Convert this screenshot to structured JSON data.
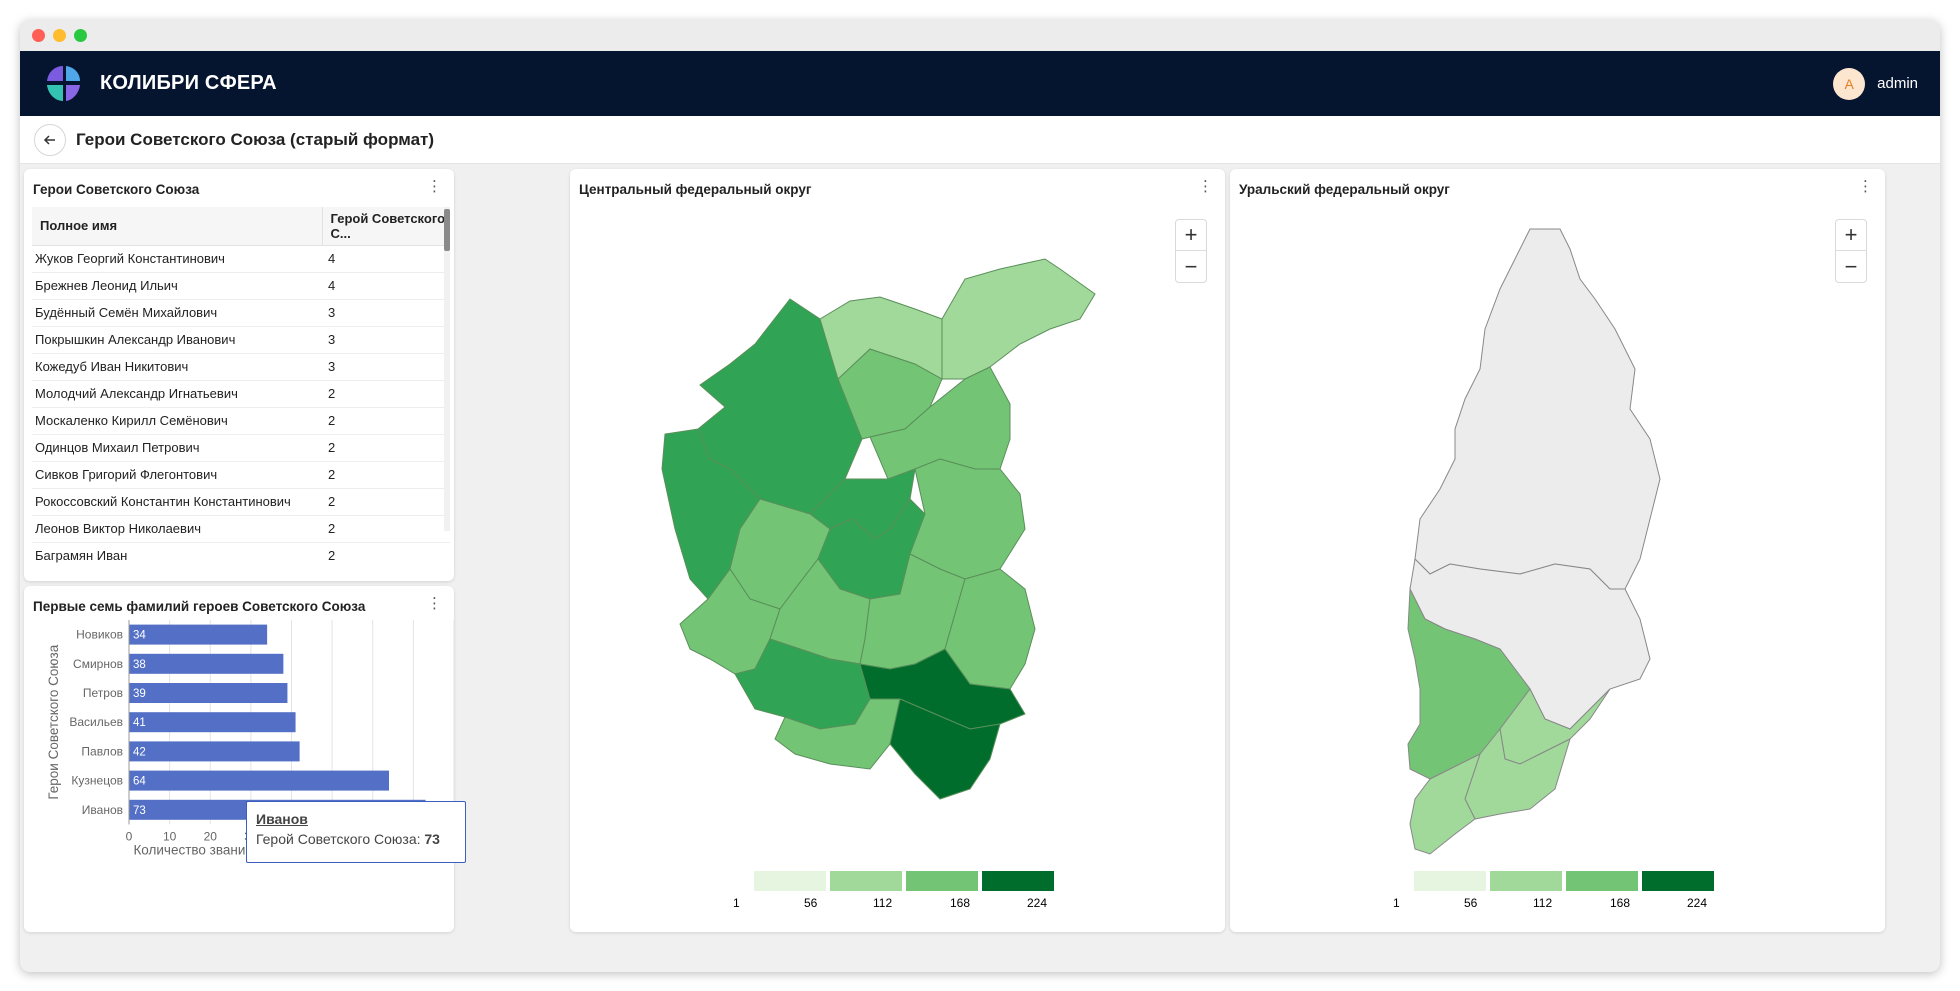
{
  "app": {
    "brand": "КОЛИБРИ СФЕРА",
    "user": "admin",
    "avatar_letter": "A"
  },
  "page": {
    "title": "Герои Советского Союза (старый формат)"
  },
  "table_panel": {
    "title": "Герои Советского Союза",
    "columns": [
      "Полное имя",
      "Герой Советского С..."
    ],
    "rows": [
      [
        "Жуков Георгий Константинович",
        "4"
      ],
      [
        "Брежнев Леонид Ильич",
        "4"
      ],
      [
        "Будённый Семён Михайлович",
        "3"
      ],
      [
        "Покрышкин Александр Иванович",
        "3"
      ],
      [
        "Кожедуб Иван Никитович",
        "3"
      ],
      [
        "Молодчий Александр Игнатьевич",
        "2"
      ],
      [
        "Москаленко Кирилл Семёнович",
        "2"
      ],
      [
        "Одинцов Михаил Петрович",
        "2"
      ],
      [
        "Сивков Григорий Флегонтович",
        "2"
      ],
      [
        "Рокоссовский Константин Константинович",
        "2"
      ],
      [
        "Леонов Виктор Николаевич",
        "2"
      ],
      [
        "Баграмян Иван",
        "2"
      ]
    ]
  },
  "chart_panel": {
    "title": "Первые семь фамилий героев Советского Союза"
  },
  "chart_data": {
    "type": "bar",
    "orientation": "horizontal",
    "categories": [
      "Новиков",
      "Смирнов",
      "Петров",
      "Васильев",
      "Павлов",
      "Кузнецов",
      "Иванов"
    ],
    "values": [
      34,
      38,
      39,
      41,
      42,
      64,
      73
    ],
    "xlabel": "Количество званий героя Советского Союза",
    "ylabel": "Герои Советского Союза",
    "xlim": [
      0,
      80
    ],
    "xticks": [
      0,
      10,
      20,
      30,
      40,
      50,
      60,
      70,
      80
    ],
    "grid": true,
    "bar_color": "#5470c6"
  },
  "tooltip": {
    "name": "Иванов",
    "label": "Герой Советского Союза:",
    "value": "73"
  },
  "map_central": {
    "title": "Центральный федеральный округ",
    "legend": [
      "1",
      "56",
      "112",
      "168",
      "224"
    ]
  },
  "map_ural": {
    "title": "Уральский федеральный округ",
    "legend": [
      "1",
      "56",
      "112",
      "168",
      "224"
    ]
  },
  "colors": {
    "header": "#06152f",
    "bar": "#5470c6",
    "map_scale": [
      "#e5f5e0",
      "#a1d99b",
      "#74c476",
      "#31a354",
      "#006d2c"
    ],
    "empty_region": "#ececec"
  }
}
